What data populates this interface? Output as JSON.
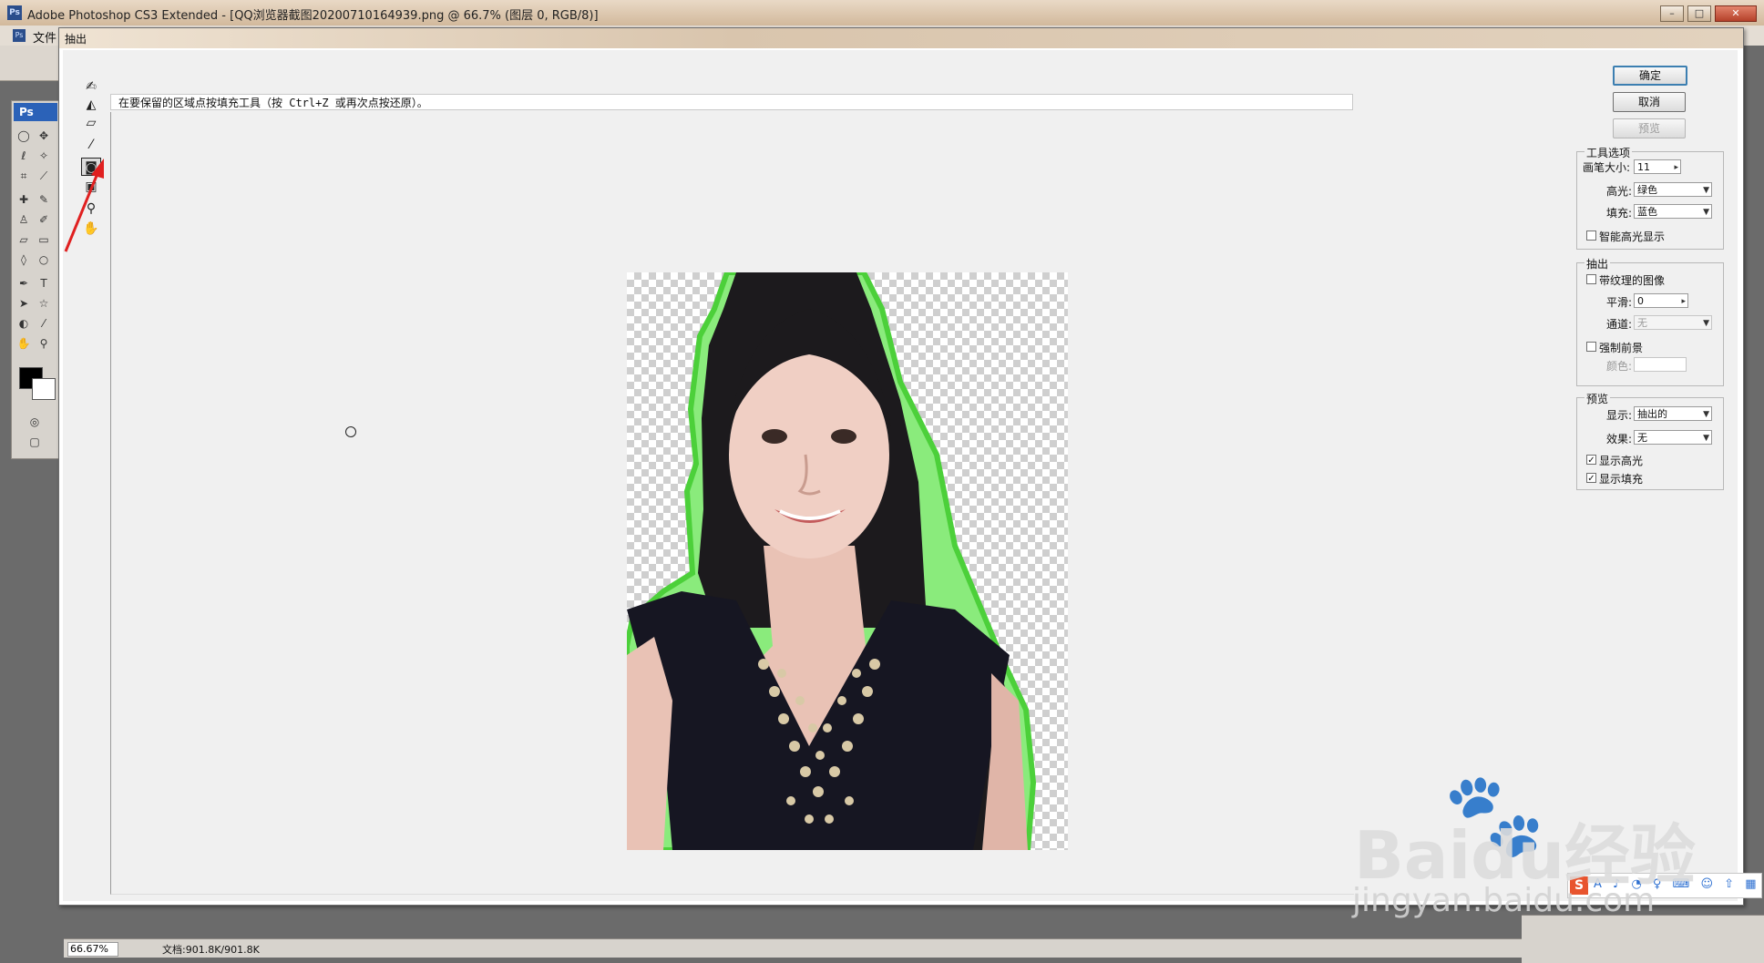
{
  "app": {
    "title": "Adobe Photoshop CS3 Extended - [QQ浏览器截图20200710164939.png @ 66.7% (图层 0, RGB/8)]",
    "logo": "Ps",
    "menu_first": "文件"
  },
  "dialog": {
    "title": "抽出",
    "hint": "在要保留的区域点按填充工具（按 Ctrl+Z 或再次点按还原）。",
    "buttons": {
      "ok": "确定",
      "cancel": "取消",
      "preview": "预览"
    },
    "tool_options": {
      "title": "工具选项",
      "brush_size_label": "画笔大小:",
      "brush_size_value": "11",
      "highlight_label": "高光:",
      "highlight_value": "绿色",
      "fill_label": "填充:",
      "fill_value": "蓝色",
      "smart_highlight_label": "智能高光显示",
      "smart_highlight_checked": false
    },
    "extraction": {
      "title": "抽出",
      "textured_label": "带纹理的图像",
      "textured_checked": false,
      "smooth_label": "平滑:",
      "smooth_value": "0",
      "channel_label": "通道:",
      "channel_value": "无",
      "force_fg_label": "强制前景",
      "force_fg_checked": false,
      "color_label": "颜色:"
    },
    "preview": {
      "title": "预览",
      "show_label": "显示:",
      "show_value": "抽出的",
      "effect_label": "效果:",
      "effect_value": "无",
      "show_highlight_label": "显示高光",
      "show_highlight_checked": true,
      "show_fill_label": "显示填充",
      "show_fill_checked": true
    },
    "colors": {
      "highlight": "#4cd03a",
      "primary_button_border": "#3c7fb1"
    }
  },
  "status": {
    "zoom": "66.67%",
    "doc": "文档:901.8K/901.8K"
  },
  "ime": {
    "logo": "S",
    "icons": "A ♪ ◔ ♀ ⌨ ☺ ⇧ ▦"
  },
  "watermark": {
    "brand": "Bai",
    "brand2": "du经验",
    "url": "jingyan.baidu.com"
  }
}
